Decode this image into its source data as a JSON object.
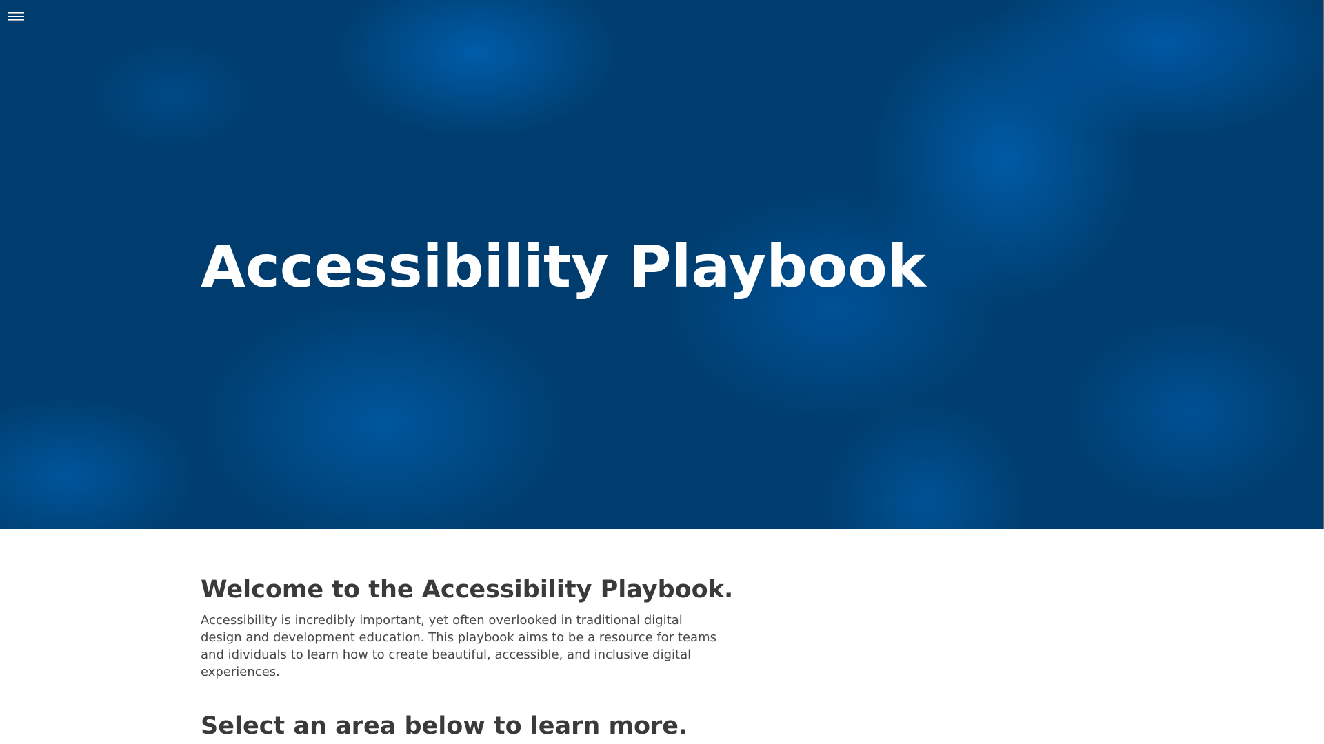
{
  "header": {
    "menu_icon": "hamburger-menu-icon"
  },
  "hero": {
    "title": "Accessibility Playbook",
    "background_color": "#003d6e",
    "accent_color": "#005aa8"
  },
  "main": {
    "welcome_heading": "Welcome to the Accessibility Playbook.",
    "intro_paragraph": "Accessibility is incredibly important, yet often overlooked in traditional digital design and development education. This playbook aims to be a resource for teams and idividuals to learn how to create beautiful, accessible, and inclusive digital experiences.",
    "select_heading": "Select an area below to learn more."
  },
  "colors": {
    "heading_text": "#3a3a3a",
    "body_text": "#474747",
    "page_background": "#ffffff"
  }
}
